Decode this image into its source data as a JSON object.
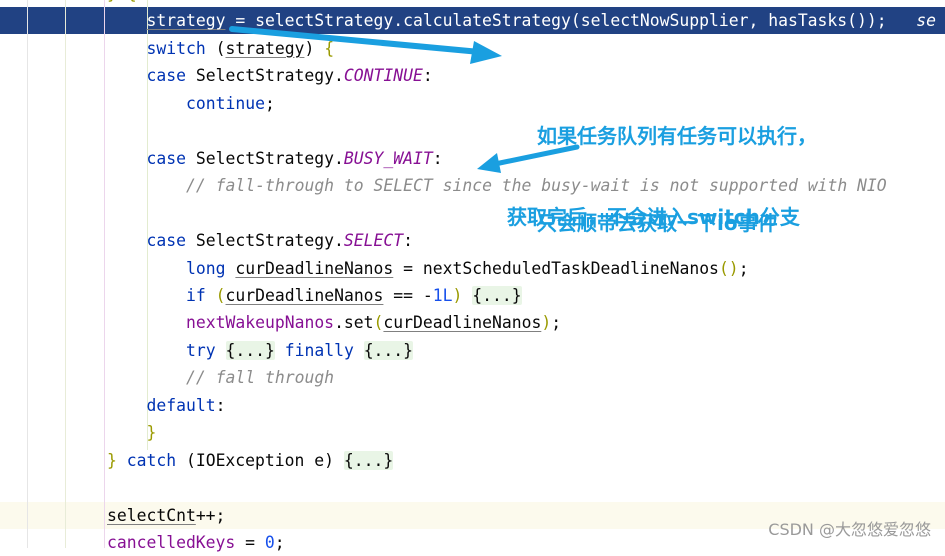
{
  "editor": {
    "highlighted_line": 1,
    "current_line": 19,
    "lines": [
      {
        "indent": 3,
        "tokens": [
          [
            "} {",
            "br"
          ]
        ]
      },
      {
        "indent": 4,
        "tokens": [
          [
            "strategy",
            "ul"
          ],
          [
            " = selectStrategy.calculateStrategy(selectNowSupplier, hasTasks());",
            ""
          ],
          [
            "   se",
            "cmt"
          ]
        ]
      },
      {
        "indent": 4,
        "tokens": [
          [
            "switch",
            "kw"
          ],
          [
            " (",
            ""
          ],
          [
            "strategy",
            "ul"
          ],
          [
            ") ",
            ""
          ],
          [
            "{",
            "br"
          ]
        ]
      },
      {
        "indent": 4,
        "tokens": [
          [
            "case",
            "kw"
          ],
          [
            " SelectStrategy.",
            ""
          ],
          [
            "CONTINUE",
            "cst"
          ],
          [
            ":",
            ""
          ]
        ]
      },
      {
        "indent": 5,
        "tokens": [
          [
            "continue",
            "kw"
          ],
          [
            ";",
            ""
          ]
        ]
      },
      {
        "indent": 4,
        "tokens": []
      },
      {
        "indent": 4,
        "tokens": [
          [
            "case",
            "kw"
          ],
          [
            " SelectStrategy.",
            ""
          ],
          [
            "BUSY_WAIT",
            "cst"
          ],
          [
            ":",
            ""
          ]
        ]
      },
      {
        "indent": 5,
        "tokens": [
          [
            "// fall-through to SELECT since the busy-wait is not supported with NIO",
            "cmt"
          ]
        ]
      },
      {
        "indent": 4,
        "tokens": []
      },
      {
        "indent": 4,
        "tokens": [
          [
            "case",
            "kw"
          ],
          [
            " SelectStrategy.",
            ""
          ],
          [
            "SELECT",
            "cst"
          ],
          [
            ":",
            ""
          ]
        ]
      },
      {
        "indent": 5,
        "tokens": [
          [
            "long",
            "kw"
          ],
          [
            " ",
            ""
          ],
          [
            "curDeadlineNanos",
            "ul"
          ],
          [
            " = nextScheduledTaskDeadlineNanos",
            ""
          ],
          [
            "()",
            "br"
          ],
          [
            ";",
            ""
          ]
        ]
      },
      {
        "indent": 5,
        "tokens": [
          [
            "if",
            "kw"
          ],
          [
            " ",
            ""
          ],
          [
            "(",
            "br"
          ],
          [
            "curDeadlineNanos",
            "ul"
          ],
          [
            " == -",
            ""
          ],
          [
            "1L",
            "num"
          ],
          [
            ")",
            "br"
          ],
          [
            " ",
            ""
          ],
          [
            "{...}",
            "fold"
          ]
        ]
      },
      {
        "indent": 5,
        "tokens": [
          [
            "nextWakeupNanos",
            "fld"
          ],
          [
            ".set",
            ""
          ],
          [
            "(",
            "br"
          ],
          [
            "curDeadlineNanos",
            "ul"
          ],
          [
            ")",
            "br"
          ],
          [
            ";",
            ""
          ]
        ]
      },
      {
        "indent": 5,
        "tokens": [
          [
            "try",
            "kw"
          ],
          [
            " ",
            ""
          ],
          [
            "{...}",
            "fold"
          ],
          [
            " ",
            ""
          ],
          [
            "finally",
            "kw"
          ],
          [
            " ",
            ""
          ],
          [
            "{...}",
            "fold"
          ]
        ]
      },
      {
        "indent": 5,
        "tokens": [
          [
            "// fall through",
            "cmt"
          ]
        ]
      },
      {
        "indent": 4,
        "tokens": [
          [
            "default",
            "kw"
          ],
          [
            ":",
            ""
          ]
        ]
      },
      {
        "indent": 4,
        "tokens": [
          [
            "}",
            "br"
          ]
        ]
      },
      {
        "indent": 3,
        "tokens": [
          [
            "}",
            "br"
          ],
          [
            " ",
            ""
          ],
          [
            "catch",
            "kw"
          ],
          [
            " (IOException e) ",
            ""
          ],
          [
            "{...}",
            "fold"
          ]
        ]
      },
      {
        "indent": 3,
        "tokens": []
      },
      {
        "indent": 3,
        "tokens": [
          [
            "selectCnt",
            "ul"
          ],
          [
            "++;",
            ""
          ]
        ]
      },
      {
        "indent": 3,
        "tokens": [
          [
            "cancelledKeys",
            "fld"
          ],
          [
            " = ",
            ""
          ],
          [
            "0",
            "num"
          ],
          [
            ";",
            ""
          ]
        ]
      }
    ]
  },
  "annotations": {
    "note1_line1": "如果任务队列有任务可以执行，",
    "note1_line2": "只会顺带去获取一下io事件",
    "note2": "获取完后，不会进入switch分支",
    "arrow_color": "#1a9fe0"
  },
  "watermark": "CSDN @大忽悠爱忽悠",
  "colors": {
    "keyword": "#0033b3",
    "field": "#871094",
    "comment": "#8c8c8c",
    "number": "#1750eb",
    "selection": "#214283",
    "current_line": "#fcfaed",
    "folded": "#e9f5e6"
  }
}
